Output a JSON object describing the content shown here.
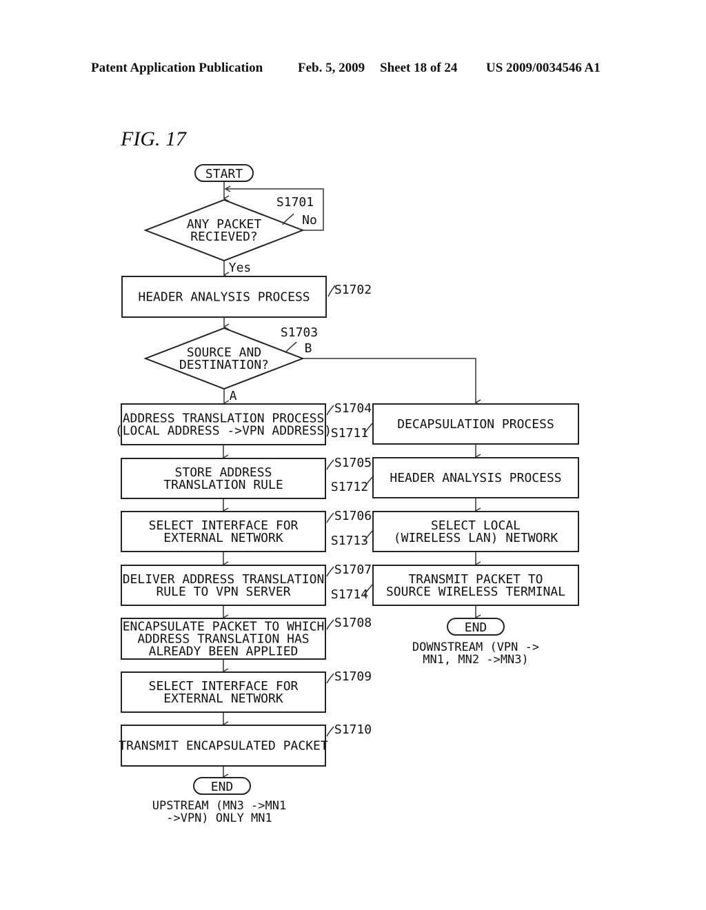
{
  "header": {
    "publication": "Patent Application Publication",
    "date": "Feb. 5, 2009",
    "sheet": "Sheet 18 of 24",
    "number": "US 2009/0034546 A1"
  },
  "figure": {
    "title": "FIG. 17",
    "start": "START",
    "decision1": {
      "step": "S1701",
      "lines": [
        "ANY PACKET",
        "RECIEVED?"
      ],
      "no_label": "No",
      "yes_label": "Yes"
    },
    "s1702": {
      "step": "S1702",
      "lines": [
        "HEADER ANALYSIS PROCESS"
      ]
    },
    "decision2": {
      "step": "S1703",
      "lines": [
        "SOURCE AND",
        "DESTINATION?"
      ],
      "a_label": "A",
      "b_label": "B"
    },
    "left_branch": [
      {
        "step": "S1704",
        "lines": [
          "ADDRESS TRANSLATION PROCESS",
          "(LOCAL ADDRESS ->VPN ADDRESS)"
        ]
      },
      {
        "step": "S1705",
        "lines": [
          "STORE ADDRESS",
          "TRANSLATION RULE"
        ]
      },
      {
        "step": "S1706",
        "lines": [
          "SELECT INTERFACE FOR",
          "EXTERNAL NETWORK"
        ]
      },
      {
        "step": "S1707",
        "lines": [
          "DELIVER ADDRESS TRANSLATION",
          "RULE TO VPN SERVER"
        ]
      },
      {
        "step": "S1708",
        "lines": [
          "ENCAPSULATE PACKET TO WHICH",
          "ADDRESS TRANSLATION HAS",
          "ALREADY BEEN APPLIED"
        ]
      },
      {
        "step": "S1709",
        "lines": [
          "SELECT INTERFACE FOR",
          "EXTERNAL NETWORK"
        ]
      },
      {
        "step": "S1710",
        "lines": [
          "TRANSMIT ENCAPSULATED PACKET"
        ]
      }
    ],
    "left_end": "END",
    "left_note": [
      "UPSTREAM (MN3 ->MN1",
      "->VPN) ONLY MN1"
    ],
    "right_branch": [
      {
        "step": "S1711",
        "lines": [
          "DECAPSULATION PROCESS"
        ]
      },
      {
        "step": "S1712",
        "lines": [
          "HEADER ANALYSIS PROCESS"
        ]
      },
      {
        "step": "S1713",
        "lines": [
          "SELECT LOCAL",
          "(WIRELESS LAN) NETWORK"
        ]
      },
      {
        "step": "S1714",
        "lines": [
          "TRANSMIT PACKET TO",
          "SOURCE WIRELESS TERMINAL"
        ]
      }
    ],
    "right_end": "END",
    "right_note": [
      "DOWNSTREAM (VPN ->",
      "MN1, MN2 ->MN3)"
    ]
  }
}
